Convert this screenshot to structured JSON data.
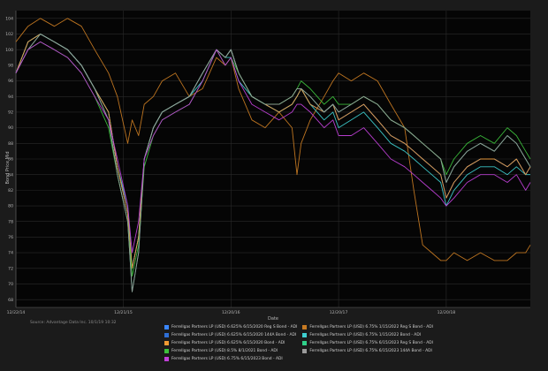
{
  "source_note": "Source: Advantage Data Inc. 10/1/19 10:32",
  "chart_data": {
    "type": "line",
    "title": "",
    "xlabel": "Date",
    "ylabel": "Bond Price Mid",
    "ylim": [
      67,
      105
    ],
    "grid": true,
    "legend_position": "bottom",
    "x_ticks": [
      "12/22/14",
      "12/21/15",
      "12/20/16",
      "12/20/17",
      "12/20/18"
    ],
    "y_ticks": [
      68,
      70,
      72,
      74,
      76,
      78,
      80,
      82,
      84,
      86,
      88,
      90,
      92,
      94,
      96,
      98,
      100,
      102,
      104
    ],
    "x": [
      "12/22/14",
      "02/01/15",
      "03/15/15",
      "05/01/15",
      "06/15/15",
      "08/01/15",
      "09/15/15",
      "11/01/15",
      "12/01/15",
      "01/05/16",
      "01/20/16",
      "02/11/16",
      "03/01/16",
      "04/01/16",
      "05/01/16",
      "06/15/16",
      "08/01/16",
      "09/15/16",
      "11/01/16",
      "12/01/16",
      "12/20/16",
      "01/15/17",
      "03/01/17",
      "04/15/17",
      "06/01/17",
      "07/15/17",
      "08/01/17",
      "08/15/17",
      "09/15/17",
      "11/01/17",
      "12/01/17",
      "12/20/17",
      "02/01/18",
      "03/15/18",
      "05/01/18",
      "06/15/18",
      "08/01/18",
      "09/01/18",
      "10/01/18",
      "11/01/18",
      "12/01/18",
      "12/20/18",
      "01/15/19",
      "03/01/19",
      "04/15/19",
      "06/01/19",
      "07/15/19",
      "08/15/19",
      "09/15/19",
      "10/01/19"
    ],
    "series": [
      {
        "name": "Ferrellgas Partners LP (USD) 6.625% 6/15/2020 Reg S Bond - ADI",
        "color": "#3a86ff",
        "values": [
          97,
          101,
          102,
          101,
          100,
          98,
          95,
          92,
          85,
          79,
          72,
          76,
          86,
          90,
          92,
          93,
          94,
          97,
          100,
          99,
          100,
          97,
          94,
          93,
          92,
          93,
          94,
          95,
          93,
          92,
          93,
          91,
          92,
          93,
          91,
          89,
          88,
          87,
          86,
          85,
          84,
          81,
          83,
          85,
          86,
          86,
          85,
          86,
          84,
          85
        ]
      },
      {
        "name": "Ferrellgas Partners LP (USD) 6.75% 1/15/2022 Reg S Bond - ADI",
        "color": "#c77a22",
        "values": [
          101,
          103,
          104,
          103,
          104,
          103,
          100,
          97,
          94,
          88,
          91,
          89,
          93,
          94,
          96,
          97,
          94,
          95,
          99,
          98,
          99,
          95,
          91,
          90,
          92,
          90,
          84,
          88,
          91,
          94,
          96,
          97,
          96,
          97,
          96,
          93,
          90,
          82,
          75,
          74,
          73,
          73,
          74,
          73,
          74,
          73,
          73,
          74,
          74,
          75
        ]
      },
      {
        "name": "Ferrellgas Partners LP (USD) 6.625% 6/15/2020 144A Bond - ADI",
        "color": "#2f6fd6",
        "values": [
          97,
          101,
          102,
          101,
          100,
          98,
          95,
          92,
          85,
          79,
          72,
          76,
          86,
          90,
          92,
          93,
          94,
          97,
          100,
          99,
          100,
          97,
          94,
          93,
          92,
          93,
          94,
          95,
          93,
          92,
          93,
          91,
          92,
          93,
          91,
          89,
          88,
          87,
          86,
          85,
          84,
          81,
          83,
          85,
          86,
          86,
          85,
          86,
          84,
          85
        ]
      },
      {
        "name": "Ferrellgas Partners LP (USD) 6.75% 1/15/2022 Bond - ADI",
        "color": "#3ecfd0",
        "values": [
          97,
          101,
          102,
          101,
          100,
          98,
          95,
          92,
          85,
          80,
          72,
          76,
          86,
          90,
          92,
          93,
          94,
          96,
          100,
          99,
          99,
          96,
          94,
          93,
          92,
          93,
          94,
          95,
          93,
          91,
          92,
          90,
          91,
          92,
          90,
          88,
          87,
          86,
          85,
          84,
          83,
          80,
          82,
          84,
          85,
          85,
          84,
          85,
          84,
          84
        ]
      },
      {
        "name": "Ferrellgas Partners LP (USD) 6.625% 6/15/2020 Bond - ADI",
        "color": "#f09a33",
        "values": [
          97,
          101,
          102,
          101,
          100,
          98,
          95,
          92,
          85,
          79,
          72,
          76,
          86,
          90,
          92,
          93,
          94,
          97,
          100,
          99,
          100,
          97,
          94,
          93,
          92,
          93,
          94,
          95,
          93,
          92,
          93,
          91,
          92,
          93,
          91,
          89,
          88,
          87,
          86,
          85,
          84,
          81,
          83,
          85,
          86,
          86,
          85,
          86,
          84,
          85
        ]
      },
      {
        "name": "Ferrellgas Partners LP (USD) 6.75% 6/15/2023 Reg S Bond - ADI",
        "color": "#2fd08a",
        "values": [
          97,
          100,
          102,
          101,
          100,
          98,
          95,
          91,
          84,
          78,
          69,
          74,
          86,
          90,
          92,
          93,
          94,
          97,
          100,
          99,
          100,
          97,
          94,
          93,
          93,
          94,
          95,
          95,
          94,
          92,
          93,
          92,
          93,
          94,
          93,
          91,
          90,
          89,
          88,
          87,
          86,
          83,
          85,
          87,
          88,
          87,
          89,
          88,
          86,
          85
        ]
      },
      {
        "name": "Ferrellgas Partners LP (USD) 8.5% 8/1/2021 Bond - ADI",
        "color": "#3cbf3c",
        "values": [
          97,
          100,
          101,
          100,
          99,
          97,
          94,
          90,
          84,
          78,
          71,
          75,
          85,
          89,
          91,
          92,
          93,
          96,
          100,
          98,
          99,
          97,
          94,
          93,
          93,
          94,
          95,
          96,
          95,
          93,
          94,
          93,
          93,
          94,
          93,
          91,
          90,
          89,
          88,
          87,
          86,
          84,
          86,
          88,
          89,
          88,
          90,
          89,
          87,
          86
        ]
      },
      {
        "name": "Ferrellgas Partners LP (USD) 6.75% 6/15/2023 144A Bond - ADI",
        "color": "#9a9a9a",
        "values": [
          97,
          100,
          102,
          101,
          100,
          98,
          95,
          91,
          84,
          78,
          69,
          74,
          86,
          90,
          92,
          93,
          94,
          97,
          100,
          99,
          100,
          97,
          94,
          93,
          93,
          94,
          95,
          95,
          94,
          92,
          93,
          92,
          93,
          94,
          93,
          91,
          90,
          89,
          88,
          87,
          86,
          83,
          85,
          87,
          88,
          87,
          89,
          88,
          86,
          85
        ]
      },
      {
        "name": "Ferrellgas Partners LP (USD) 6.75% 6/15/2023 Bond - ADI",
        "color": "#c040d8",
        "values": [
          97,
          100,
          101,
          100,
          99,
          97,
          94,
          91,
          86,
          80,
          74,
          78,
          86,
          89,
          91,
          92,
          93,
          96,
          100,
          98,
          99,
          96,
          93,
          92,
          91,
          92,
          93,
          93,
          92,
          90,
          91,
          89,
          89,
          90,
          88,
          86,
          85,
          84,
          83,
          82,
          81,
          80,
          81,
          83,
          84,
          84,
          83,
          84,
          82,
          83
        ]
      }
    ]
  }
}
